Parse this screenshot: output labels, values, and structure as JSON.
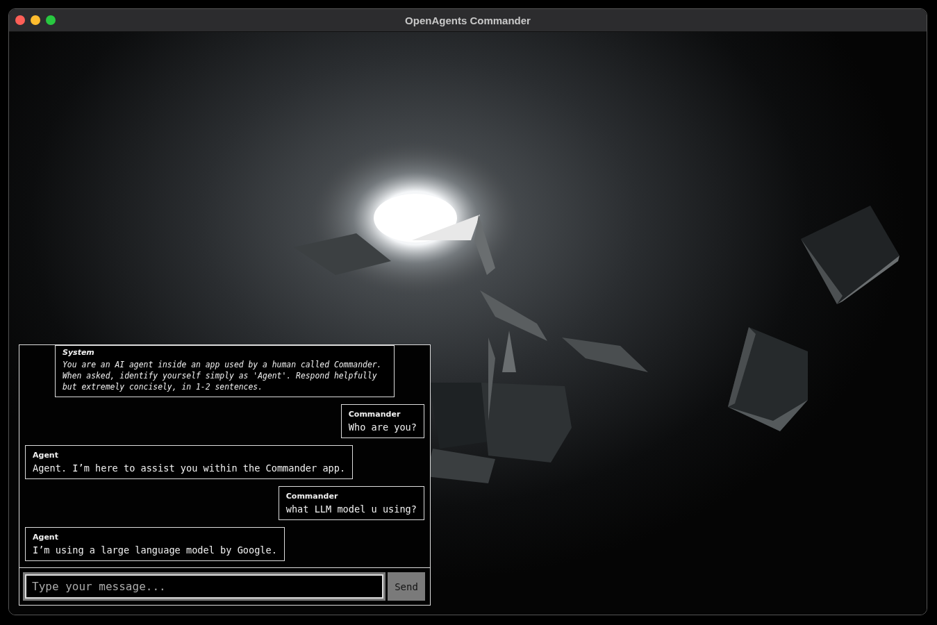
{
  "window": {
    "title": "OpenAgents Commander"
  },
  "chat": {
    "messages": [
      {
        "kind": "system",
        "sender": "System",
        "text": "You are an AI agent inside an app used by a human called Commander. When asked, identify yourself simply as 'Agent'. Respond helpfully but extremely concisely, in 1-2 sentences."
      },
      {
        "kind": "user",
        "sender": "Commander",
        "text": "Who are you?"
      },
      {
        "kind": "agent",
        "sender": "Agent",
        "text": "Agent. I’m here to assist you within the Commander app."
      },
      {
        "kind": "user",
        "sender": "Commander",
        "text": "what LLM model u using?"
      },
      {
        "kind": "agent",
        "sender": "Agent",
        "text": "I’m using a large language model by Google."
      }
    ],
    "input": {
      "placeholder": "Type your message..."
    },
    "send_button": "Send"
  }
}
